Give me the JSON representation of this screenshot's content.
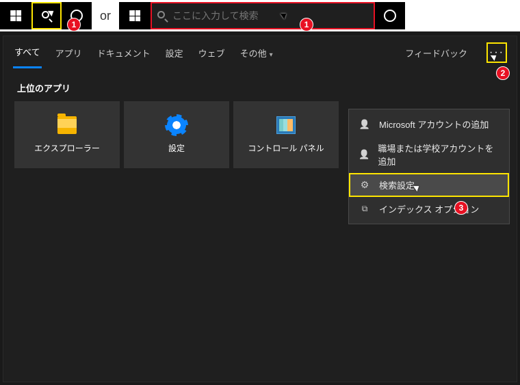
{
  "topbar": {
    "or_label": "or",
    "search_placeholder": "ここに入力して検索"
  },
  "tabs": {
    "all": "すべて",
    "apps": "アプリ",
    "documents": "ドキュメント",
    "settings": "設定",
    "web": "ウェブ",
    "more": "その他"
  },
  "feedback_label": "フィードバック",
  "more_dots": "···",
  "section_top_apps": "上位のアプリ",
  "top_apps": [
    {
      "label": "エクスプローラー"
    },
    {
      "label": "設定"
    },
    {
      "label": "コントロール パネル"
    }
  ],
  "menu": {
    "add_ms_account": "Microsoft アカウントの追加",
    "add_work_account": "職場または学校アカウントを追加",
    "search_settings": "検索設定",
    "index_options": "インデックス オプション"
  },
  "badges": {
    "b1": "1",
    "b1b": "1",
    "b2": "2",
    "b3": "3"
  }
}
